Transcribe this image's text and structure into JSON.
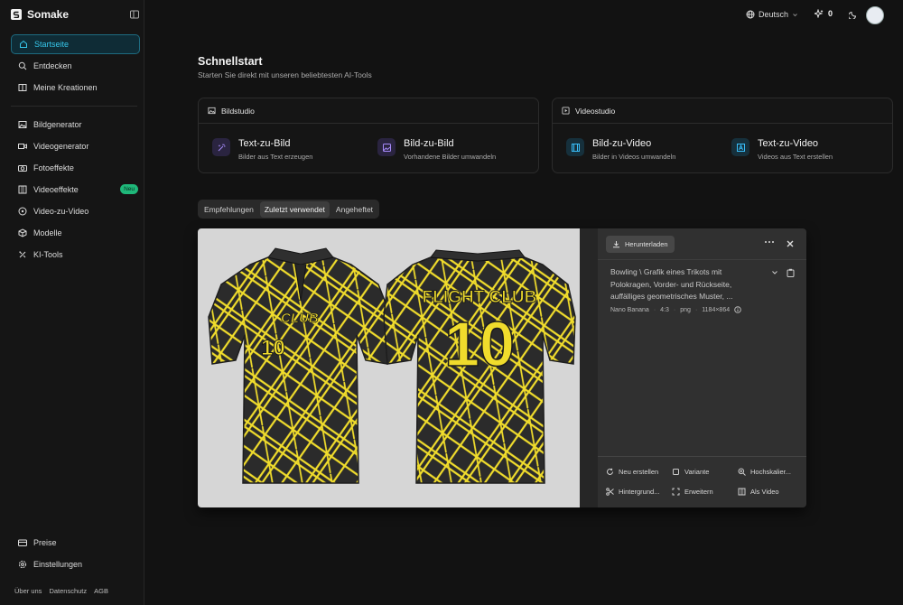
{
  "app": {
    "name": "Somake"
  },
  "sidebar": {
    "items": [
      {
        "label": "Startseite",
        "icon": "home-icon",
        "active": true
      },
      {
        "label": "Entdecken",
        "icon": "search-icon"
      },
      {
        "label": "Meine Kreationen",
        "icon": "book-icon"
      },
      {
        "label": "Bildgenerator",
        "icon": "image-icon"
      },
      {
        "label": "Videogenerator",
        "icon": "video-icon"
      },
      {
        "label": "Fotoeffekte",
        "icon": "camera-icon"
      },
      {
        "label": "Videoeffekte",
        "icon": "film-icon",
        "badge": "Neu"
      },
      {
        "label": "Video-zu-Video",
        "icon": "play-circle-icon"
      },
      {
        "label": "Modelle",
        "icon": "cube-icon"
      },
      {
        "label": "KI-Tools",
        "icon": "tools-icon"
      }
    ],
    "bottom": [
      {
        "label": "Preise",
        "icon": "credit-card-icon"
      },
      {
        "label": "Einstellungen",
        "icon": "gear-icon"
      }
    ],
    "footer_links": [
      "Über uns",
      "Datenschutz",
      "AGB"
    ]
  },
  "topbar": {
    "language": "Deutsch",
    "credits": "0"
  },
  "quickstart": {
    "title": "Schnellstart",
    "subtitle": "Starten Sie direkt mit unseren beliebtesten AI-Tools",
    "studios": [
      {
        "title": "Bildstudio",
        "tools": [
          {
            "title": "Text-zu-Bild",
            "desc": "Bilder aus Text erzeugen"
          },
          {
            "title": "Bild-zu-Bild",
            "desc": "Vorhandene Bilder umwandeln"
          }
        ]
      },
      {
        "title": "Videostudio",
        "tools": [
          {
            "title": "Bild-zu-Video",
            "desc": "Bilder in Videos umwandeln"
          },
          {
            "title": "Text-zu-Video",
            "desc": "Videos aus Text erstellen"
          }
        ]
      }
    ]
  },
  "tabs": {
    "items": [
      "Empfehlungen",
      "Zuletzt verwendet",
      "Angeheftet"
    ],
    "active": 1
  },
  "viewer": {
    "download": "Herunterladen",
    "prompt": "Bowling \\ Grafik eines Trikots mit Polokragen, Vorder- und Rückseite, auffälliges geometrisches Muster, ...",
    "meta": {
      "model": "Nano Banana",
      "ratio": "4:3",
      "format": "png",
      "size": "1184×864"
    },
    "jersey": {
      "front_text": "CLUB",
      "number": "10",
      "back_text": "FLIGHT CLUB"
    },
    "actions": [
      "Neu erstellen",
      "Variante",
      "Hochskalier...",
      "Hintergrund...",
      "Erweitern",
      "Als Video"
    ]
  },
  "colors": {
    "accent": "#36c6ea",
    "jersey_base": "#2b2b2b",
    "jersey_pattern": "#f0dc2c",
    "badge": "#1fb87a"
  }
}
